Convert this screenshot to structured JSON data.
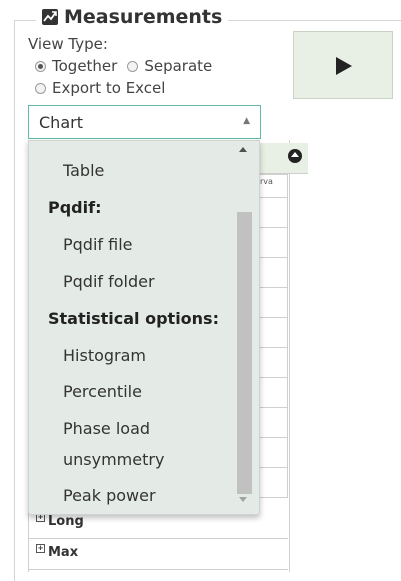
{
  "panel": {
    "title": "Measurements",
    "icon": "chart-icon"
  },
  "view_type": {
    "label": "View Type:",
    "options": [
      {
        "label": "Together",
        "checked": true
      },
      {
        "label": "Separate",
        "checked": false
      },
      {
        "label": "Export to Excel",
        "checked": false
      }
    ]
  },
  "play_button": {
    "icon": "play-icon"
  },
  "select": {
    "value": "Chart"
  },
  "dropdown": {
    "items": {
      "table": "Table",
      "group_pqdif": "Pqdif:",
      "pqdif_file": "Pqdif file",
      "pqdif_folder": "Pqdif folder",
      "group_stat": "Statistical options:",
      "histogram": "Histogram",
      "percentile": "Percentile",
      "phase_load_1": "Phase load",
      "phase_load_2": "unsymmetry",
      "peak_power": "Peak power"
    }
  },
  "background_table": {
    "column_fragment": "rva",
    "rows": [
      "Long",
      "Max"
    ]
  }
}
